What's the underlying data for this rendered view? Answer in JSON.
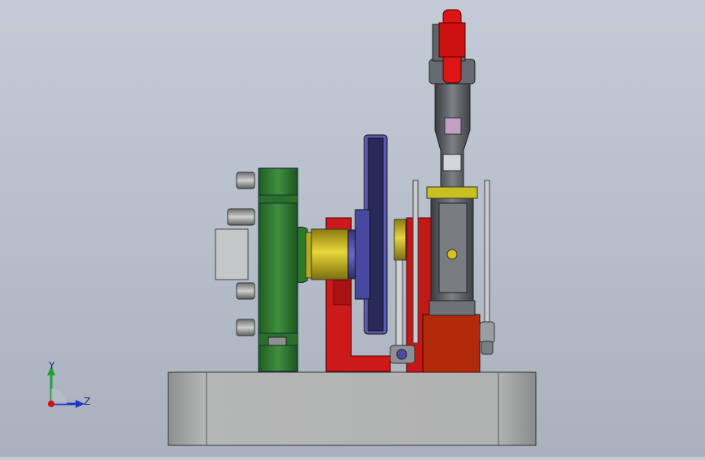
{
  "triad": {
    "y_label": "Y",
    "z_label": "Z",
    "colors": {
      "y": "#22a033",
      "z": "#2233cc",
      "origin": "#cc1111"
    }
  },
  "model_colors": {
    "flywheel_hub": "#2e7d32",
    "crank_bracket": "#cc1a1a",
    "shaft_collar": "#d4c21a",
    "bearing": "#4a4aa8",
    "disc": "#2a2a5a",
    "cylinder": "#6c7075",
    "block": "#b32a0a",
    "base": "#a9abaa",
    "bolts": "#9a9a9a"
  }
}
